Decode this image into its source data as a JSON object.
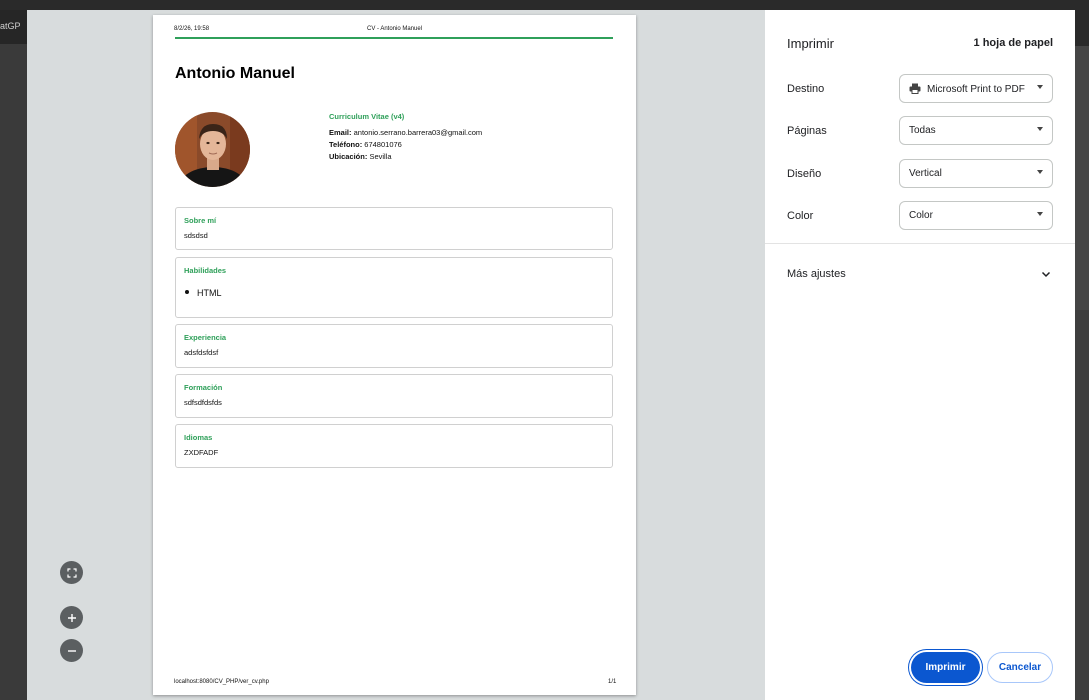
{
  "background": {
    "left_tab_text": "atGP"
  },
  "page": {
    "header_date": "8/2/26, 19:58",
    "header_title": "CV - Antonio Manuel",
    "name": "Antonio Manuel",
    "version": "Curriculum Vitae (v4)",
    "email_label": "Email:",
    "email": "antonio.serrano.barrera03@gmail.com",
    "phone_label": "Teléfono:",
    "phone": "674801076",
    "location_label": "Ubicación:",
    "location": "Sevilla",
    "sections": [
      {
        "title": "Sobre mí",
        "text": "sdsdsd"
      },
      {
        "title": "Habilidades",
        "items": [
          "HTML"
        ]
      },
      {
        "title": "Experiencia",
        "text": "adsfdsfdsf"
      },
      {
        "title": "Formación",
        "text": "sdfsdfdsfds"
      },
      {
        "title": "Idiomas",
        "text": "ZXDFADF"
      }
    ],
    "footer_url": "localhost:8080/CV_PHP/ver_cv.php",
    "footer_page": "1/1"
  },
  "zoom": {
    "fit_icon": "fit-to-page-icon",
    "zoom_in_icon": "plus-icon",
    "zoom_out_icon": "minus-icon"
  },
  "settings": {
    "title": "Imprimir",
    "sheet_count": "1 hoja de papel",
    "destination_label": "Destino",
    "destination_value": "Microsoft Print to PDF",
    "pages_label": "Páginas",
    "pages_value": "Todas",
    "layout_label": "Diseño",
    "layout_value": "Vertical",
    "color_label": "Color",
    "color_value": "Color",
    "more_settings": "Más ajustes",
    "print_button": "Imprimir",
    "cancel_button": "Cancelar"
  },
  "colors": {
    "accent_green": "#2fa05a",
    "primary_blue": "#0b57d0"
  }
}
